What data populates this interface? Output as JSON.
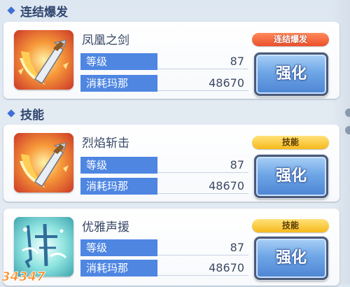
{
  "sections": {
    "burst": {
      "title": "连结爆发"
    },
    "skills": {
      "title": "技能"
    }
  },
  "cards": [
    {
      "name": "凤凰之剑",
      "badge": "连结爆发",
      "level_label": "等级",
      "level": "87",
      "cost_label": "消耗玛那",
      "cost": "48670",
      "button": "强化",
      "icon": "phoenix-sword-icon"
    },
    {
      "name": "烈焰斩击",
      "badge": "技能",
      "level_label": "等级",
      "level": "87",
      "cost_label": "消耗玛那",
      "cost": "48670",
      "button": "强化",
      "icon": "flame-slash-icon"
    },
    {
      "name": "优雅声援",
      "badge": "技能",
      "level_label": "等级",
      "level": "87",
      "cost_label": "消耗玛那",
      "cost": "48670",
      "button": "强化",
      "icon": "graceful-cheer-icon"
    }
  ],
  "watermark": {
    "text": "34347"
  },
  "colors": {
    "stat_label_bg": "#4e86e2",
    "badge_burst": "#ec4f2c",
    "badge_skill": "#f5b91b",
    "button": "#5b92dc"
  }
}
